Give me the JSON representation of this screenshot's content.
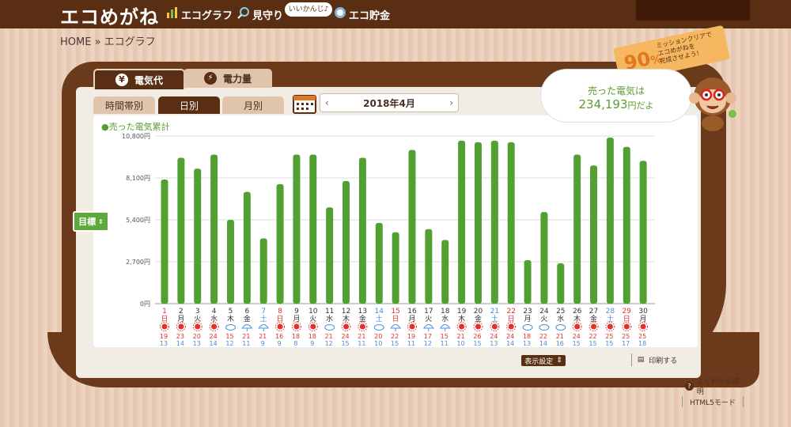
{
  "header": {
    "logo": "エコめがね",
    "nav": [
      "エコグラフ",
      "見守り",
      "エコ貯金"
    ],
    "speech": "いいかんじ♪"
  },
  "breadcrumb": "HOME » エコグラフ",
  "tabs": {
    "main": [
      "電気代",
      "電力量"
    ],
    "sub": [
      "時間帯別",
      "日別",
      "月別"
    ]
  },
  "month": "2018年4月",
  "bubble": {
    "line1": "売った電気は",
    "amount": "234,193",
    "suffix": "円だよ"
  },
  "mission": {
    "pct": "90",
    "pct_unit": "%",
    "text": "ミッションクリアで\nエコめがねを\n完成させよう!"
  },
  "goal_button": "目標",
  "settings_button": "表示設定",
  "print_button": "印刷する",
  "faq_link": "よくわかる説明",
  "html5_link": "HTML5モード",
  "colors": {
    "bar": "#52a031",
    "dark_brown": "#5a2e12",
    "sat": "#4a8fd8",
    "sun": "#e0322a"
  },
  "chart_data": {
    "type": "bar",
    "legend": "●売った電気累計",
    "yticks": [
      "10,800円",
      "8,100円",
      "5,400円",
      "2,700円",
      "0円"
    ],
    "ylim": [
      0,
      10800
    ],
    "days": [
      "1",
      "2",
      "3",
      "4",
      "5",
      "6",
      "7",
      "8",
      "9",
      "10",
      "11",
      "12",
      "13",
      "14",
      "15",
      "16",
      "17",
      "18",
      "19",
      "20",
      "21",
      "22",
      "23",
      "24",
      "25",
      "26",
      "27",
      "28",
      "29",
      "30"
    ],
    "weekdays": [
      "日",
      "月",
      "火",
      "水",
      "木",
      "金",
      "土",
      "日",
      "月",
      "火",
      "水",
      "木",
      "金",
      "土",
      "日",
      "月",
      "火",
      "水",
      "木",
      "金",
      "土",
      "日",
      "月",
      "火",
      "水",
      "木",
      "金",
      "土",
      "日",
      "月"
    ],
    "values": [
      8000,
      9400,
      8700,
      9600,
      5400,
      7200,
      4200,
      7700,
      9600,
      9600,
      6200,
      7900,
      9400,
      5200,
      4600,
      9900,
      4800,
      4100,
      10500,
      10400,
      10500,
      10400,
      2800,
      5900,
      2600,
      9600,
      8900,
      10700,
      10100,
      9200
    ],
    "weather": [
      "sun",
      "sun",
      "sun",
      "sun",
      "cloud",
      "rain",
      "rain",
      "sun",
      "sun",
      "sun",
      "cloud",
      "sun",
      "sun",
      "cloud",
      "rain",
      "sun",
      "rain",
      "rain",
      "sun",
      "sun",
      "sun",
      "sun",
      "cloud",
      "cloud",
      "cloud",
      "sun",
      "sun",
      "sun",
      "sun",
      "sun"
    ],
    "high": [
      "19",
      "23",
      "20",
      "24",
      "15",
      "21",
      "21",
      "16",
      "18",
      "18",
      "21",
      "24",
      "21",
      "20",
      "22",
      "19",
      "17",
      "15",
      "21",
      "26",
      "24",
      "24",
      "18",
      "22",
      "21",
      "24",
      "22",
      "25",
      "25",
      "25"
    ],
    "low": [
      "13",
      "14",
      "13",
      "14",
      "12",
      "11",
      "9",
      "9",
      "8",
      "9",
      "12",
      "15",
      "11",
      "10",
      "15",
      "11",
      "12",
      "11",
      "10",
      "15",
      "13",
      "14",
      "13",
      "14",
      "16",
      "15",
      "15",
      "15",
      "17",
      "18"
    ]
  }
}
